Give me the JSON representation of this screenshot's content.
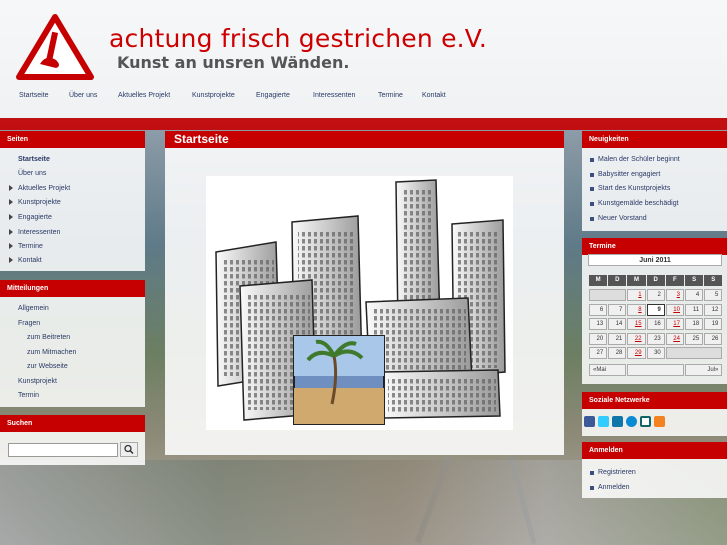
{
  "header": {
    "title": "achtung frisch gestrichen e.V.",
    "subtitle": "Kunst an unsren Wänden."
  },
  "nav": [
    "Startseite",
    "Über uns",
    "Aktuelles Projekt",
    "Kunstprojekte",
    "Engagierte",
    "Interessenten",
    "Termine",
    "Kontakt"
  ],
  "sidebar_left": {
    "seiten": {
      "title": "Seiten",
      "items": [
        {
          "label": "Startseite",
          "arrow": false
        },
        {
          "label": "Über uns",
          "arrow": false
        },
        {
          "label": "Aktuelles Projekt",
          "arrow": true
        },
        {
          "label": "Kunstprojekte",
          "arrow": true
        },
        {
          "label": "Engagierte",
          "arrow": true
        },
        {
          "label": "Interessenten",
          "arrow": true
        },
        {
          "label": "Termine",
          "arrow": true
        },
        {
          "label": "Kontakt",
          "arrow": true
        }
      ]
    },
    "mitteilungen": {
      "title": "Mitteilungen",
      "items": [
        "Allgemein",
        "Fragen",
        "zum Beitreten",
        "zum Mitmachen",
        "zur Webseite",
        "Kunstprojekt",
        "Termin"
      ]
    },
    "suchen": {
      "title": "Suchen",
      "placeholder": ""
    }
  },
  "main": {
    "title": "Startseite"
  },
  "sidebar_right": {
    "neuigkeiten": {
      "title": "Neuigkeiten",
      "items": [
        "Malen der Schüler beginnt",
        "Babysitter engagiert",
        "Start des Kunstprojekts",
        "Kunstgemälde beschädigt",
        "Neuer Vorstand"
      ]
    },
    "termine": {
      "title": "Termine",
      "month": "Juni  2011",
      "weekdays": [
        "M",
        "D",
        "M",
        "D",
        "F",
        "S",
        "S"
      ],
      "rows": [
        [
          "",
          "",
          "1",
          "2",
          "3",
          "4",
          "5"
        ],
        [
          "6",
          "7",
          "8",
          "9",
          "10",
          "11",
          "12"
        ],
        [
          "13",
          "14",
          "15",
          "16",
          "17",
          "18",
          "19"
        ],
        [
          "20",
          "21",
          "22",
          "23",
          "24",
          "25",
          "26"
        ],
        [
          "27",
          "28",
          "29",
          "30",
          "",
          "",
          ""
        ]
      ],
      "event_days": [
        "1",
        "3",
        "8",
        "10",
        "15",
        "17",
        "22",
        "24",
        "29"
      ],
      "today": "9",
      "prev": "«Mai",
      "next": "Jul»"
    },
    "soziale": {
      "title": "Soziale Netzwerke",
      "icons": [
        "facebook-icon",
        "twitter-icon",
        "linkedin-icon",
        "skype-icon",
        "xing-icon",
        "rss-icon"
      ]
    },
    "anmelden": {
      "title": "Anmelden",
      "items": [
        "Registrieren",
        "Anmelden"
      ]
    }
  }
}
